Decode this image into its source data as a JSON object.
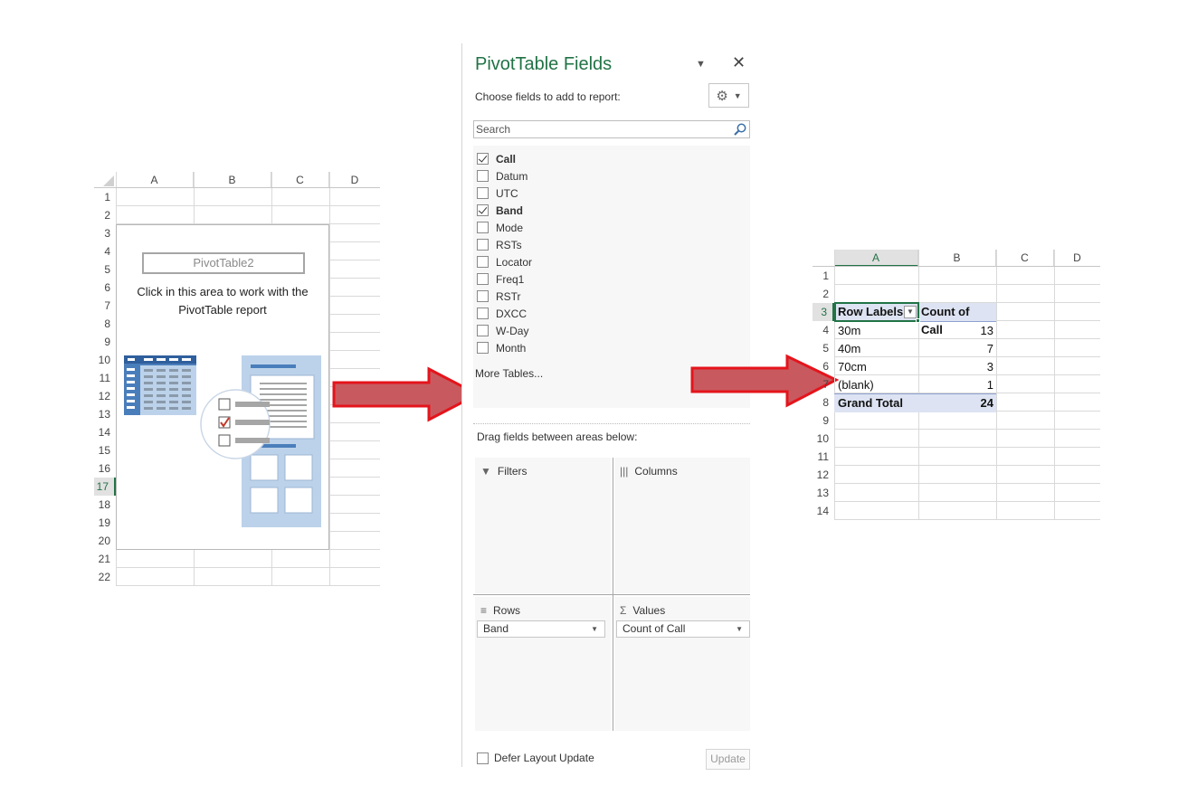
{
  "left_sheet": {
    "columns": [
      "A",
      "B",
      "C",
      "D"
    ],
    "rows": [
      "1",
      "2",
      "3",
      "4",
      "5",
      "6",
      "7",
      "8",
      "9",
      "10",
      "11",
      "12",
      "13",
      "14",
      "15",
      "16",
      "17",
      "18",
      "19",
      "20",
      "21",
      "22"
    ],
    "active_row": "17",
    "pivot_placeholder": {
      "name": "PivotTable2",
      "hint_line1": "Click in this area to work with the",
      "hint_line2": "PivotTable report"
    }
  },
  "field_pane": {
    "title": "PivotTable Fields",
    "subtitle": "Choose fields to add to report:",
    "search_placeholder": "Search",
    "fields": [
      {
        "label": "Call",
        "checked": true
      },
      {
        "label": "Datum",
        "checked": false
      },
      {
        "label": "UTC",
        "checked": false
      },
      {
        "label": "Band",
        "checked": true
      },
      {
        "label": "Mode",
        "checked": false
      },
      {
        "label": "RSTs",
        "checked": false
      },
      {
        "label": "Locator",
        "checked": false
      },
      {
        "label": "Freq1",
        "checked": false
      },
      {
        "label": "RSTr",
        "checked": false
      },
      {
        "label": "DXCC",
        "checked": false
      },
      {
        "label": "W-Day",
        "checked": false
      },
      {
        "label": "Month",
        "checked": false
      }
    ],
    "more_tables": "More Tables...",
    "drag_hint": "Drag fields between areas below:",
    "areas": {
      "filters": {
        "label": "Filters"
      },
      "columns": {
        "label": "Columns"
      },
      "rows": {
        "label": "Rows",
        "field": "Band"
      },
      "values": {
        "label": "Values",
        "field": "Count of Call"
      }
    },
    "defer_label": "Defer Layout Update",
    "update_label": "Update"
  },
  "right_sheet": {
    "columns": [
      "A",
      "B",
      "C",
      "D"
    ],
    "rows": [
      "1",
      "2",
      "3",
      "4",
      "5",
      "6",
      "7",
      "8",
      "9",
      "10",
      "11",
      "12",
      "13",
      "14"
    ],
    "active_row": "3",
    "pivot": {
      "header_label": "Row Labels",
      "header_value": "Count of Call",
      "items": [
        {
          "label": "30m",
          "value": "13"
        },
        {
          "label": "40m",
          "value": "7"
        },
        {
          "label": "70cm",
          "value": "3"
        },
        {
          "label": "(blank)",
          "value": "1"
        }
      ],
      "total_label": "Grand Total",
      "total_value": "24"
    }
  },
  "colors": {
    "accent_green": "#217346",
    "arrow_fill": "#c85a5f",
    "arrow_border": "#e5141c",
    "pivot_header_bg": "#dde3f2",
    "icon_blue": "#4a7ebb",
    "icon_light_blue": "#bcd2ea"
  }
}
